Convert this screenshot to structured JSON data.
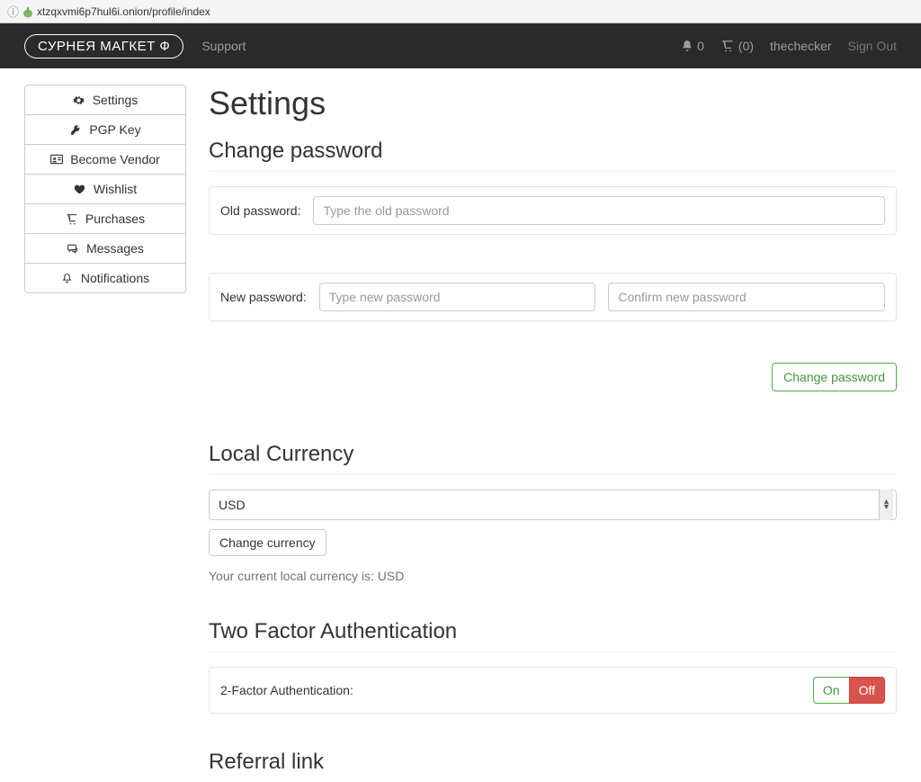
{
  "url": "xtzqxvmi6p7hul6i.onion/profile/index",
  "navbar": {
    "brand": "СУРНЕЯ МАГКЕТ Ф",
    "support": "Support",
    "bell_count": "0",
    "cart_count": "(0)",
    "username": "thechecker",
    "signout": "Sign Out"
  },
  "sidebar": {
    "items": [
      {
        "icon": "gear",
        "label": "Settings"
      },
      {
        "icon": "key",
        "label": "PGP Key"
      },
      {
        "icon": "idcard",
        "label": "Become Vendor"
      },
      {
        "icon": "heart",
        "label": "Wishlist"
      },
      {
        "icon": "cart",
        "label": "Purchases"
      },
      {
        "icon": "chat",
        "label": "Messages"
      },
      {
        "icon": "bell",
        "label": "Notifications"
      }
    ]
  },
  "page": {
    "title": "Settings",
    "change_password": {
      "heading": "Change password",
      "old_label": "Old password:",
      "old_placeholder": "Type the old password",
      "new_label": "New password:",
      "new_placeholder": "Type new password",
      "confirm_placeholder": "Confirm new password",
      "button": "Change password"
    },
    "currency": {
      "heading": "Local Currency",
      "value": "USD",
      "button": "Change currency",
      "note_prefix": "Your current local currency is: ",
      "note_value": "USD"
    },
    "tfa": {
      "heading": "Two Factor Authentication",
      "label": "2-Factor Authentication:",
      "on": "On",
      "off": "Off"
    },
    "referral": {
      "heading": "Referral link"
    }
  }
}
